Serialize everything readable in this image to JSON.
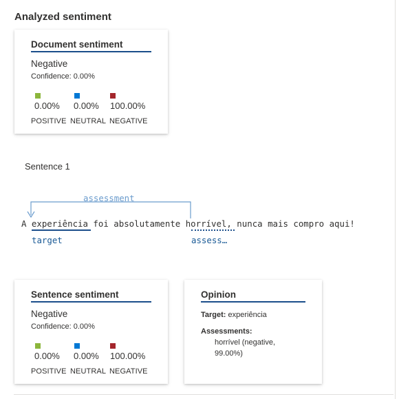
{
  "page": {
    "title": "Analyzed sentiment"
  },
  "document_card": {
    "title": "Document sentiment",
    "sentiment": "Negative",
    "confidence": "Confidence: 0.00%",
    "scores": [
      {
        "value": "0.00%",
        "label": "POSITIVE",
        "color": "#8cb63c"
      },
      {
        "value": "0.00%",
        "label": "NEUTRAL",
        "color": "#0078d4"
      },
      {
        "value": "100.00%",
        "label": "NEGATIVE",
        "color": "#a4262c"
      }
    ]
  },
  "sentence": {
    "label": "Sentence 1",
    "text": "A experiência foi absolutamente horrível, nunca mais compro aqui!",
    "relation_label": "assessment",
    "target_tag": "target",
    "assessment_tag": "assess…"
  },
  "sentence_card": {
    "title": "Sentence sentiment",
    "sentiment": "Negative",
    "confidence": "Confidence: 0.00%",
    "scores": [
      {
        "value": "0.00%",
        "label": "POSITIVE",
        "color": "#8cb63c"
      },
      {
        "value": "0.00%",
        "label": "NEUTRAL",
        "color": "#0078d4"
      },
      {
        "value": "100.00%",
        "label": "NEGATIVE",
        "color": "#a4262c"
      }
    ]
  },
  "opinion_card": {
    "title": "Opinion",
    "target_key": "Target:",
    "target_value": "experiência",
    "assessments_key": "Assessments:",
    "assessment_line1": "horrível (negative,",
    "assessment_line2": "99.00%)"
  },
  "colors": {
    "accent": "#1a4e8a",
    "link": "#1a5a96",
    "arc": "#6b9ccd"
  }
}
